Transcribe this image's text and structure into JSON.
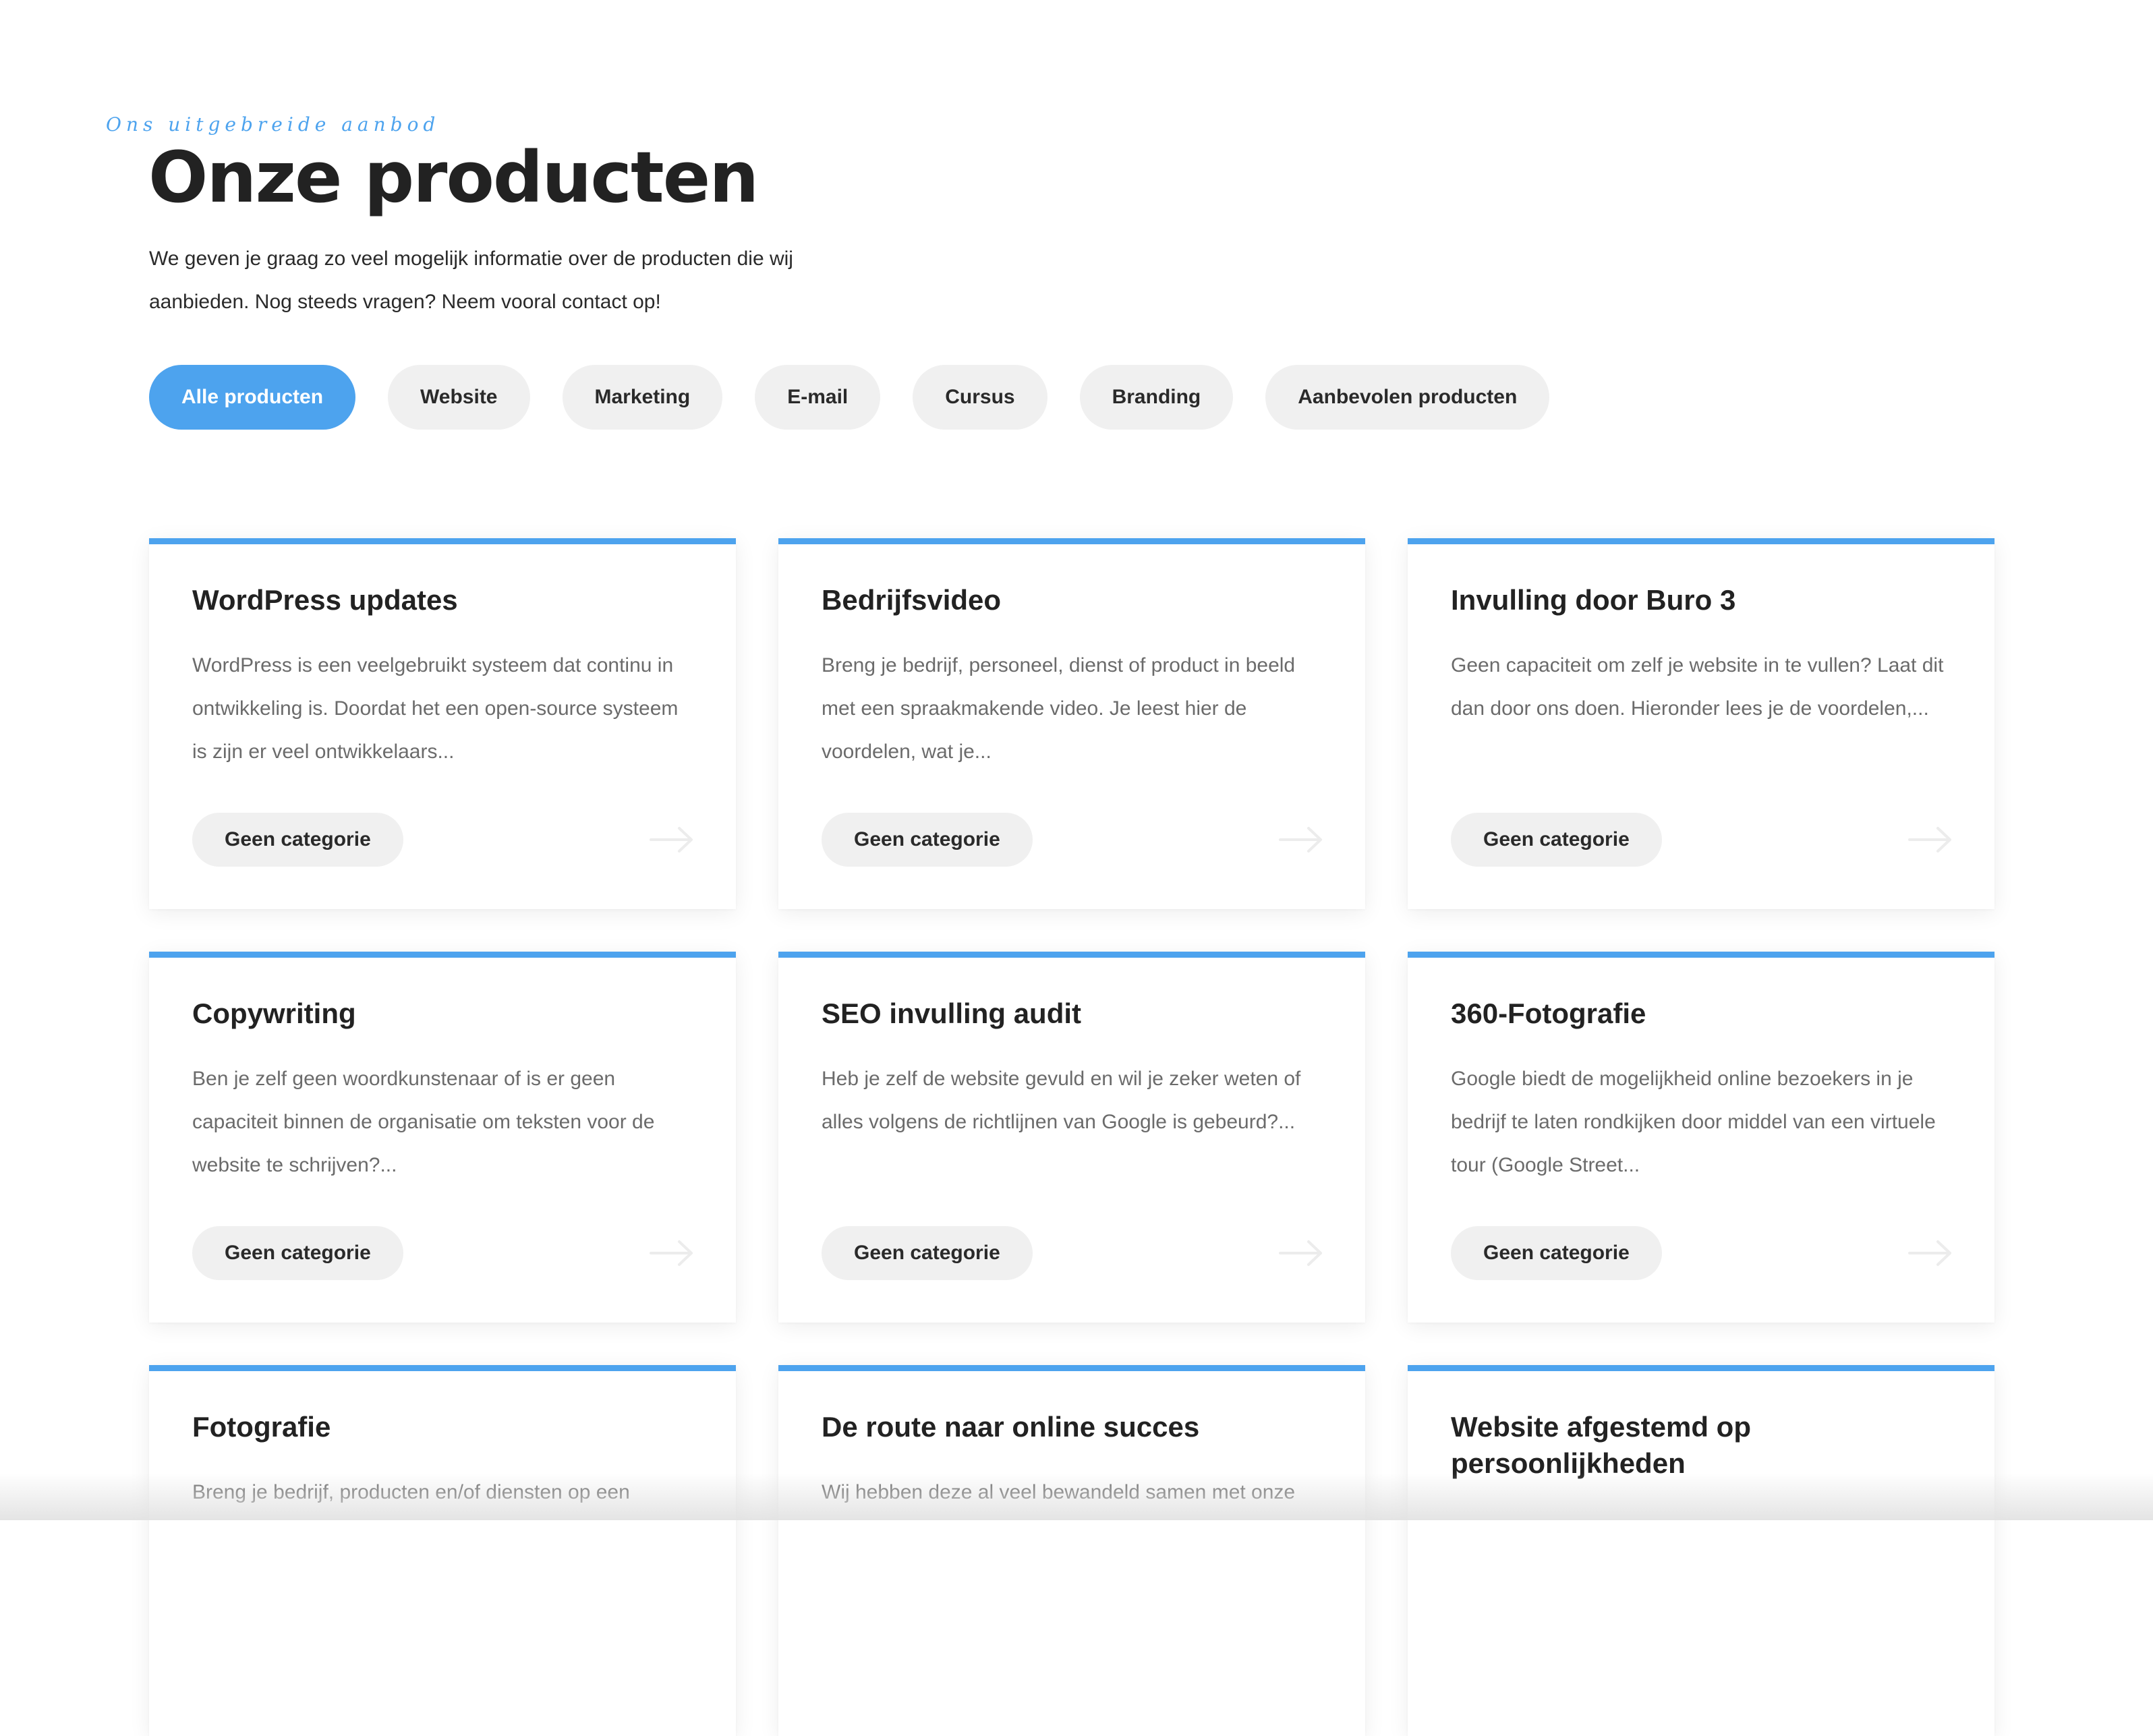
{
  "header": {
    "eyebrow": "Ons uitgebreide aanbod",
    "title": "Onze producten",
    "intro": "We geven je graag zo veel mogelijk informatie over de producten die wij aanbieden. Nog steeds vragen? Neem vooral contact op!"
  },
  "filters": {
    "active": "Alle producten",
    "items": [
      "Alle producten",
      "Website",
      "Marketing",
      "E-mail",
      "Cursus",
      "Branding",
      "Aanbevolen producten"
    ]
  },
  "colors": {
    "accent": "#4da3ee",
    "pill_background": "#f0f0f0",
    "title_text": "#222222",
    "body_text": "#6b6b6b"
  },
  "icons": {
    "card_link": "arrow-right-icon"
  },
  "products": [
    {
      "title": "WordPress updates",
      "description": "WordPress is een veelgebruikt systeem dat continu in ontwikkeling is. Doordat het een open-source systeem is zijn er veel ontwikkelaars...",
      "category": "Geen categorie"
    },
    {
      "title": "Bedrijfsvideo",
      "description": "Breng je bedrijf, personeel, dienst of product in beeld met een spraakmakende video. Je leest hier de voordelen, wat je...",
      "category": "Geen categorie"
    },
    {
      "title": "Invulling door Buro 3",
      "description": "Geen capaciteit om zelf je website in te vullen? Laat dit dan door ons doen. Hieronder lees je de voordelen,...",
      "category": "Geen categorie"
    },
    {
      "title": "Copywriting",
      "description": "Ben je zelf geen woordkunstenaar of is er geen capaciteit binnen de organisatie om teksten voor de website te schrijven?...",
      "category": "Geen categorie"
    },
    {
      "title": "SEO invulling audit",
      "description": "Heb je zelf de website gevuld en wil je zeker weten of alles volgens de richtlijnen van Google is gebeurd?...",
      "category": "Geen categorie"
    },
    {
      "title": "360-Fotografie",
      "description": "Google biedt de mogelijkheid online bezoekers in je bedrijf te laten rondkijken door middel van een virtuele tour (Google Street...",
      "category": "Geen categorie"
    },
    {
      "title": "Fotografie",
      "description": "Breng je bedrijf, producten en/of diensten op een",
      "category": ""
    },
    {
      "title": "De route naar online succes",
      "description": "Wij hebben deze al veel bewandeld samen met onze",
      "category": ""
    },
    {
      "title": "Website afgestemd op persoonlijkheden",
      "description": "",
      "category": ""
    }
  ]
}
